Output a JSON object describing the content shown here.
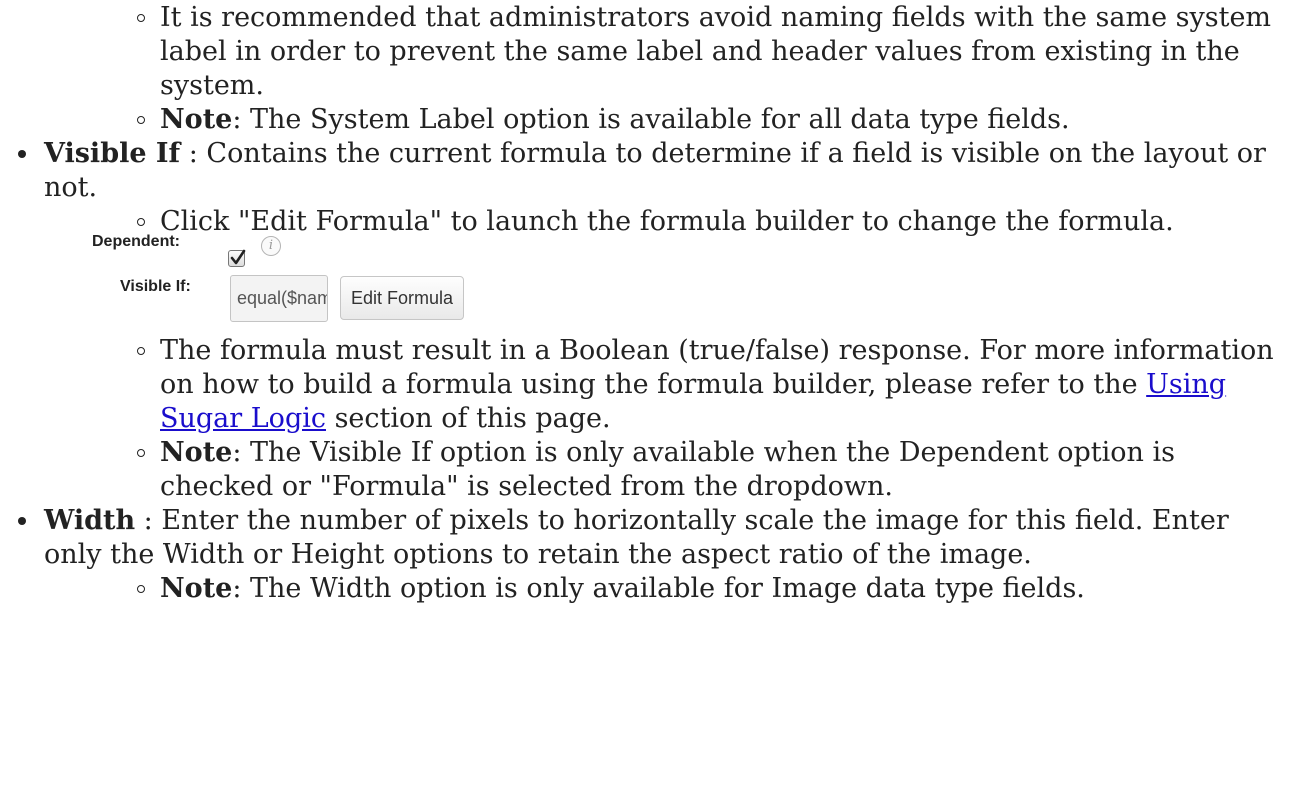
{
  "system_label_subitems": {
    "recommend": "It is recommended that administrators avoid naming fields with the same system label in order to prevent the same label and header values from existing in the system.",
    "note_label": "Note",
    "note_text": ": The System Label option is available for all data type fields."
  },
  "visible_if": {
    "term": "Visible If",
    "desc": " : Contains the current formula to determine if a field is visible on the layout or not.",
    "sub1": "Click \"Edit Formula\" to launch the formula builder to change the formula.",
    "screenshot": {
      "dependent_label": "Dependent:",
      "dependent_checked": true,
      "info_icon_glyph": "i",
      "visible_if_label": "Visible If:",
      "formula_value": "equal($name,\"SugarCF",
      "edit_button_label": "Edit Formula"
    },
    "sub2_before": "The formula must result in a Boolean (true/false) response. For more information on how to build a formula using the formula builder, please refer to the ",
    "sub2_link": "Using Sugar Logic",
    "sub2_after": " section of this page.",
    "note_label": "Note",
    "note_text": ": The Visible If option is only available when the Dependent option is checked or \"Formula\" is selected from the dropdown."
  },
  "width": {
    "term": "Width",
    "desc": " : Enter the number of pixels to horizontally scale the image for this field. Enter only the Width or Height options to retain the aspect ratio of the image.",
    "note_label": "Note",
    "note_text": ": The Width option is only available for Image data type fields."
  },
  "colors": {
    "text": "#222222",
    "link": "#1a0dcc"
  }
}
